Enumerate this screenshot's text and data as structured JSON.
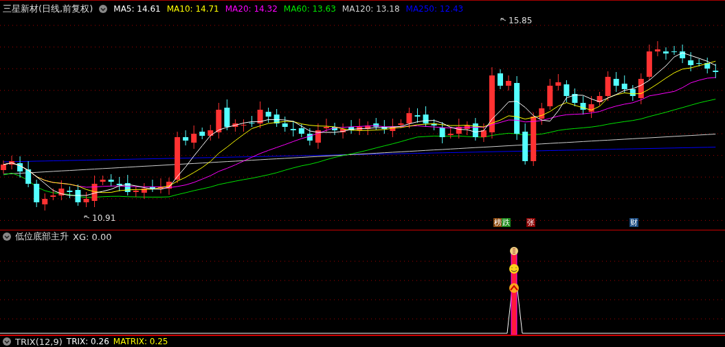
{
  "main_chart": {
    "title": "三星新材(日线,前复权)",
    "legend": [
      {
        "label": "MA5: 14.61",
        "color": "#ffffff"
      },
      {
        "label": "MA10: 14.71",
        "color": "#ffff00"
      },
      {
        "label": "MA20: 14.32",
        "color": "#ff00ff"
      },
      {
        "label": "MA60: 13.63",
        "color": "#00e600"
      },
      {
        "label": "MA120: 13.18",
        "color": "#d0d0d0"
      },
      {
        "label": "MA250: 12.43",
        "color": "#0000ff"
      }
    ],
    "high_label": "15.85",
    "low_label": "10.91",
    "markers": [
      {
        "text": "榜",
        "color": "#8b4a10"
      },
      {
        "text": "跌",
        "color": "#1a8a1a"
      },
      {
        "text": "张",
        "color": "#8b0000"
      },
      {
        "text": "财",
        "color": "#1a4a80"
      }
    ]
  },
  "indicator": {
    "title": "低位底部主升",
    "reading": "XG: 0.00"
  },
  "bottom_indicator": {
    "title": "TRIX(12,9)",
    "legend": [
      {
        "label": "TRIX: 0.26",
        "color": "#ffffff"
      },
      {
        "label": "MATRIX: 0.25",
        "color": "#ffff00"
      }
    ]
  }
}
